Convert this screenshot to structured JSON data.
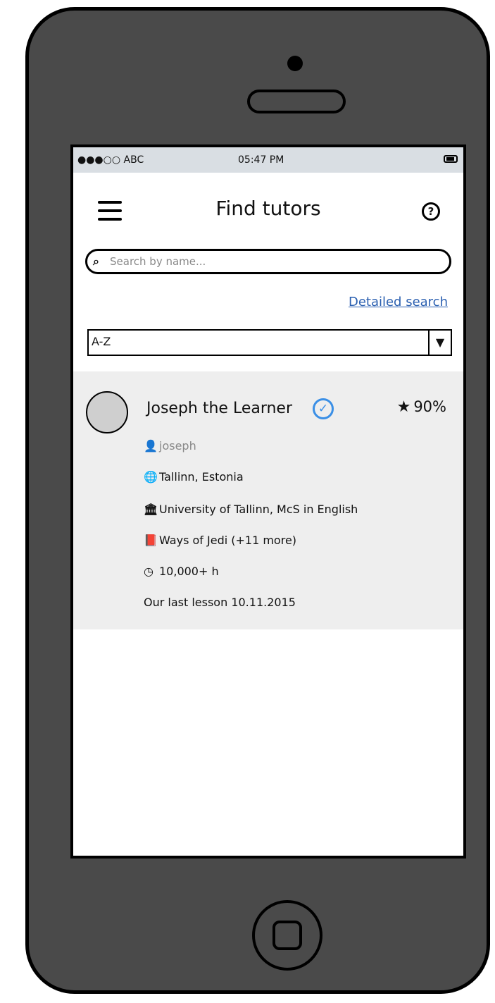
{
  "status_bar": {
    "carrier": "●●●○○ ABC",
    "time": "05:47 PM"
  },
  "header": {
    "title": "Find tutors",
    "help": "?"
  },
  "search": {
    "placeholder": "Search by name..."
  },
  "links": {
    "detailed_search": "Detailed search"
  },
  "sort": {
    "selected": "A-Z"
  },
  "tutors": [
    {
      "name": "Joseph the Learner",
      "verified": true,
      "rating": "90%",
      "username": "joseph",
      "location": "Tallinn, Estonia",
      "education": "University of Tallinn, McS in English",
      "subjects": "Ways of Jedi (+11 more)",
      "hours": "10,000+ h",
      "last_lesson": "Our last lesson 10.11.2015"
    }
  ],
  "icons": {
    "menu": "hamburger-icon",
    "help": "question-icon",
    "search": "magnifier-icon",
    "verified": "check-circle-icon",
    "rating": "star-icon",
    "user": "user-icon",
    "location": "globe-icon",
    "education": "university-icon",
    "subjects": "book-icon",
    "hours": "clock-icon"
  },
  "colors": {
    "link": "#2a5fb0",
    "verified": "#3a8fe6",
    "card_bg": "#eeeeee",
    "status_bar_bg": "#d9dee3",
    "phone_body": "#4a4a4a"
  }
}
